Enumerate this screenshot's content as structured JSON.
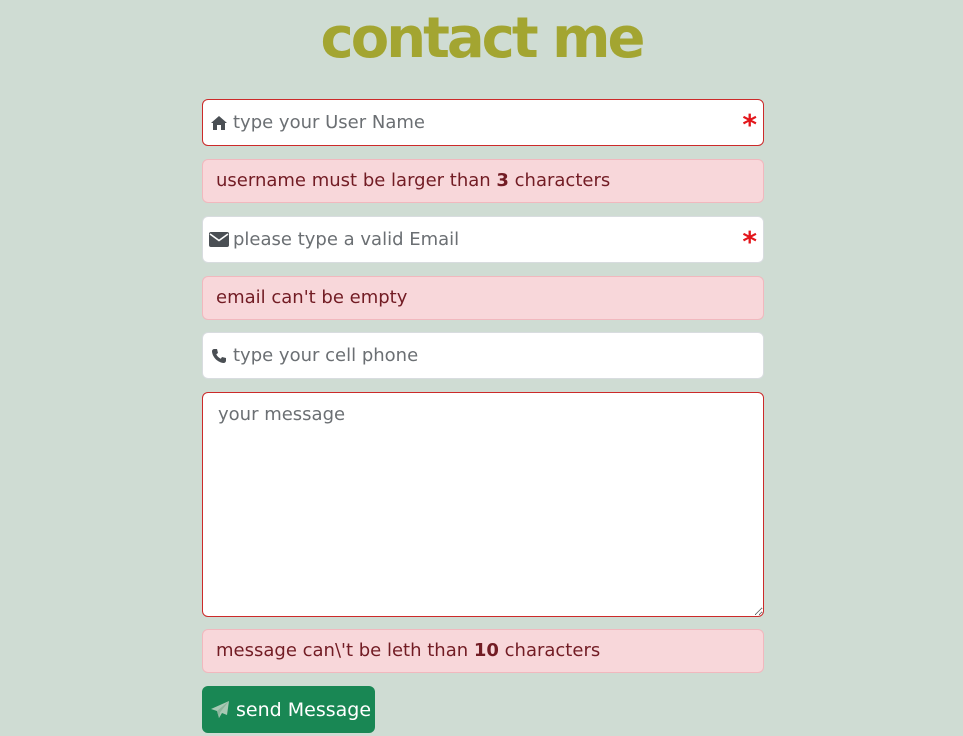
{
  "page": {
    "title": "contact me"
  },
  "form": {
    "username": {
      "placeholder": "type your User Name",
      "required_mark": "*",
      "icon": "home-icon"
    },
    "username_error": {
      "prefix": "username must be larger than ",
      "number": "3",
      "suffix": " characters"
    },
    "email": {
      "placeholder": "please type a valid Email",
      "required_mark": "*",
      "icon": "envelope-icon"
    },
    "email_error": {
      "text": "email can't be empty"
    },
    "phone": {
      "placeholder": "type your cell phone",
      "icon": "phone-icon"
    },
    "message": {
      "placeholder": "your message"
    },
    "message_error": {
      "prefix": "message can\\'t be leth than ",
      "number": "10",
      "suffix": " characters"
    },
    "submit": {
      "label": "send Message",
      "icon": "paper-plane-icon"
    }
  },
  "colors": {
    "background": "#cfdcd3",
    "title": "#a3a531",
    "error_bg": "#f8d7da",
    "error_text": "#721c24",
    "invalid_border": "#cc2a2a",
    "required": "#e3161b",
    "button": "#198754"
  }
}
